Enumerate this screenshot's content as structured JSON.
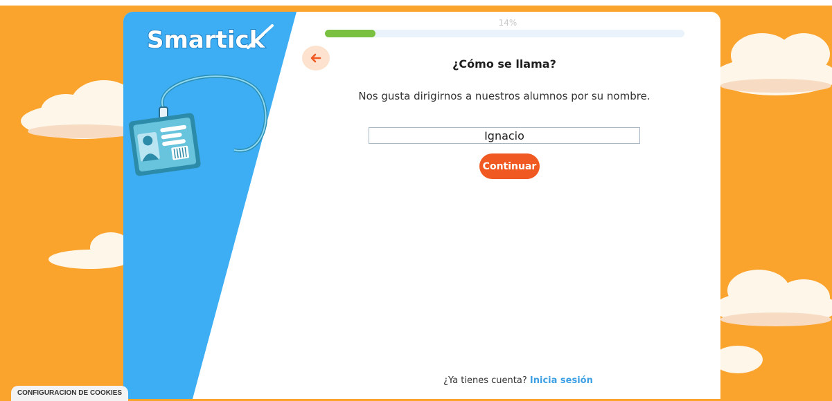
{
  "brand": {
    "logo_text": "Smartick"
  },
  "progress": {
    "label": "14%",
    "value": 0.14
  },
  "back_button": {
    "icon": "arrow-left-icon"
  },
  "question": {
    "title": "¿Cómo se llama?"
  },
  "subtitle": "Nos gusta dirigirnos a nuestros alumnos por su nombre.",
  "name_input": {
    "value": "Ignacio"
  },
  "continue_button": {
    "label": "Continuar"
  },
  "login": {
    "prompt": "¿Ya tienes cuenta?",
    "link": "Inicia sesión"
  },
  "cookie_button": {
    "label": "CONFIGURACION DE COOKIES"
  },
  "colors": {
    "background": "#fba42d",
    "panel_blue": "#3eaef4",
    "progress_green": "#7ac142",
    "accent_orange": "#f05a22",
    "link_blue": "#3ea0e4"
  }
}
